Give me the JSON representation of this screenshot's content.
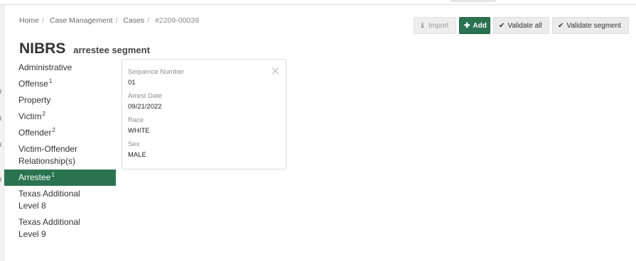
{
  "breadcrumb": {
    "items": [
      "Home",
      "Case Management",
      "Cases"
    ],
    "current": "#2209-00039",
    "separator": "/"
  },
  "title": {
    "main": "NIBRS",
    "sub": "arrestee segment"
  },
  "toolbar": {
    "import_label": "Import",
    "add_label": "Add",
    "validate_all_label": "Validate all",
    "validate_segment_label": "Validate segment"
  },
  "nav": {
    "items": [
      {
        "label": "Administrative",
        "count": ""
      },
      {
        "label": "Offense",
        "count": "1"
      },
      {
        "label": "Property",
        "count": ""
      },
      {
        "label": "Victim",
        "count": "2"
      },
      {
        "label": "Offender",
        "count": "2"
      },
      {
        "label": "Victim-Offender Relationship(s)",
        "line1": "Victim-Offender",
        "line2": "Relationship(s)",
        "count": ""
      },
      {
        "label": "Arrestee",
        "count": "1",
        "active": true
      },
      {
        "label": "Texas Additional Level 8",
        "line1": "Texas Additional",
        "line2": "Level 8",
        "count": ""
      },
      {
        "label": "Texas Additional Level 9",
        "line1": "Texas Additional",
        "line2": "Level 9",
        "count": ""
      }
    ]
  },
  "card": {
    "fields": [
      {
        "label": "Sequence Number",
        "value": "01"
      },
      {
        "label": "Arrest Date",
        "value": "09/21/2022"
      },
      {
        "label": "Race",
        "value": "WHITE"
      },
      {
        "label": "Sex",
        "value": "MALE"
      }
    ]
  },
  "colors": {
    "accent": "#2a7350",
    "button_bg": "#ebebeb"
  },
  "icons": {
    "import": "import-icon",
    "add": "plus-icon",
    "validate": "check-icon",
    "close": "close-icon"
  }
}
